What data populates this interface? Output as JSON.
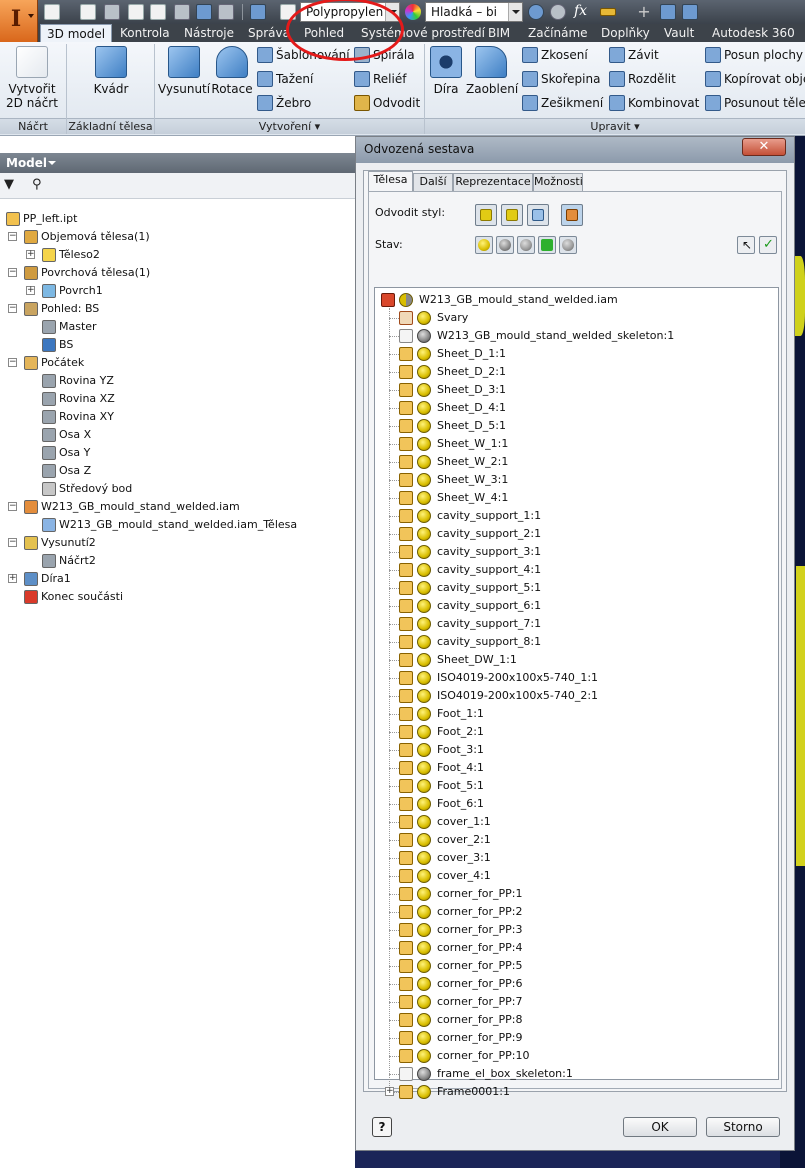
{
  "app": {
    "logo_letter": "I",
    "material": "Polypropylen",
    "appearance": "Hladká – bi",
    "fx_label": "fx",
    "menus": [
      "3D model",
      "Kontrola",
      "Nástroje",
      "Správa",
      "Pohled",
      "Systémové prostředí",
      "BIM",
      "Začínáme",
      "Doplňky",
      "Vault",
      "Autodesk 360"
    ],
    "active_menu": "3D model"
  },
  "ribbon": {
    "sketch_btn": "Vytvořit",
    "sketch_btn2": "2D náčrt",
    "box_btn": "Kvádr",
    "extrude_btn": "Vysunutí",
    "revolve_btn": "Rotace",
    "sweep_btn": "Šablonování",
    "loft_btn": "Tažení",
    "rib_btn": "Žebro",
    "coil_btn": "Spirála",
    "emboss_btn": "Reliéf",
    "derive_btn": "Odvodit",
    "hole_btn": "Díra",
    "fillet_btn": "Zaoblení",
    "chamfer_btn": "Zkosení",
    "shell_btn": "Skořepina",
    "draft_btn": "Zešikmení",
    "thread_btn": "Závit",
    "split_btn": "Rozdělit",
    "combine_btn": "Kombinovat",
    "moveface_btn": "Posun plochy",
    "copyobj_btn": "Kopírovat objek",
    "movebody_btn": "Posunout tělesa",
    "groups": {
      "sketch": "Náčrt",
      "primitives": "Základní tělesa",
      "create": "Vytvoření ▾",
      "modify": "Upravit ▾"
    }
  },
  "browser": {
    "title": "Model",
    "nodes": [
      {
        "label": "PP_left.ipt",
        "indent": 0,
        "exp": ""
      },
      {
        "label": "Objemová tělesa(1)",
        "indent": 1,
        "exp": "-"
      },
      {
        "label": "Těleso2",
        "indent": 2,
        "exp": "+"
      },
      {
        "label": "Povrchová tělesa(1)",
        "indent": 1,
        "exp": "-"
      },
      {
        "label": "Povrch1",
        "indent": 2,
        "exp": "+"
      },
      {
        "label": "Pohled: BS",
        "indent": 1,
        "exp": "-"
      },
      {
        "label": "Master",
        "indent": 2,
        "exp": ""
      },
      {
        "label": "BS",
        "indent": 2,
        "exp": ""
      },
      {
        "label": "Počátek",
        "indent": 1,
        "exp": "-"
      },
      {
        "label": "Rovina YZ",
        "indent": 2,
        "exp": ""
      },
      {
        "label": "Rovina XZ",
        "indent": 2,
        "exp": ""
      },
      {
        "label": "Rovina XY",
        "indent": 2,
        "exp": ""
      },
      {
        "label": "Osa X",
        "indent": 2,
        "exp": ""
      },
      {
        "label": "Osa Y",
        "indent": 2,
        "exp": ""
      },
      {
        "label": "Osa Z",
        "indent": 2,
        "exp": ""
      },
      {
        "label": "Středový bod",
        "indent": 2,
        "exp": ""
      },
      {
        "label": "W213_GB_mould_stand_welded.iam",
        "indent": 1,
        "exp": "-"
      },
      {
        "label": "W213_GB_mould_stand_welded.iam_Tělesa",
        "indent": 2,
        "exp": ""
      },
      {
        "label": "Vysunutí2",
        "indent": 1,
        "exp": "-"
      },
      {
        "label": "Náčrt2",
        "indent": 2,
        "exp": ""
      },
      {
        "label": "Díra1",
        "indent": 1,
        "exp": "+"
      },
      {
        "label": "Konec součásti",
        "indent": 1,
        "exp": ""
      }
    ]
  },
  "dialog": {
    "title": "Odvozená sestava",
    "close_label": "✕",
    "tabs": [
      "Tělesa",
      "Další",
      "Reprezentace",
      "Možnosti"
    ],
    "active_tab": "Tělesa",
    "derive_style_label": "Odvodit styl:",
    "status_label": "Stav:",
    "ok_label": "OK",
    "cancel_label": "Storno",
    "help_label": "?",
    "root": "W213_GB_mould_stand_welded.iam",
    "components": [
      {
        "label": "Svary",
        "state": "include",
        "kind": "weld"
      },
      {
        "label": "W213_GB_mould_stand_welded_skeleton:1",
        "state": "exclude",
        "kind": "skeleton"
      },
      {
        "label": "Sheet_D_1:1",
        "state": "include",
        "kind": "part"
      },
      {
        "label": "Sheet_D_2:1",
        "state": "include",
        "kind": "part"
      },
      {
        "label": "Sheet_D_3:1",
        "state": "include",
        "kind": "part"
      },
      {
        "label": "Sheet_D_4:1",
        "state": "include",
        "kind": "part"
      },
      {
        "label": "Sheet_D_5:1",
        "state": "include",
        "kind": "part"
      },
      {
        "label": "Sheet_W_1:1",
        "state": "include",
        "kind": "part"
      },
      {
        "label": "Sheet_W_2:1",
        "state": "include",
        "kind": "part"
      },
      {
        "label": "Sheet_W_3:1",
        "state": "include",
        "kind": "part"
      },
      {
        "label": "Sheet_W_4:1",
        "state": "include",
        "kind": "part"
      },
      {
        "label": "cavity_support_1:1",
        "state": "include",
        "kind": "part"
      },
      {
        "label": "cavity_support_2:1",
        "state": "include",
        "kind": "part"
      },
      {
        "label": "cavity_support_3:1",
        "state": "include",
        "kind": "part"
      },
      {
        "label": "cavity_support_4:1",
        "state": "include",
        "kind": "part"
      },
      {
        "label": "cavity_support_5:1",
        "state": "include",
        "kind": "part"
      },
      {
        "label": "cavity_support_6:1",
        "state": "include",
        "kind": "part"
      },
      {
        "label": "cavity_support_7:1",
        "state": "include",
        "kind": "part"
      },
      {
        "label": "cavity_support_8:1",
        "state": "include",
        "kind": "part"
      },
      {
        "label": "Sheet_DW_1:1",
        "state": "include",
        "kind": "part"
      },
      {
        "label": "ISO4019-200x100x5-740_1:1",
        "state": "include",
        "kind": "part"
      },
      {
        "label": "ISO4019-200x100x5-740_2:1",
        "state": "include",
        "kind": "part"
      },
      {
        "label": "Foot_1:1",
        "state": "include",
        "kind": "part"
      },
      {
        "label": "Foot_2:1",
        "state": "include",
        "kind": "part"
      },
      {
        "label": "Foot_3:1",
        "state": "include",
        "kind": "part"
      },
      {
        "label": "Foot_4:1",
        "state": "include",
        "kind": "part"
      },
      {
        "label": "Foot_5:1",
        "state": "include",
        "kind": "part"
      },
      {
        "label": "Foot_6:1",
        "state": "include",
        "kind": "part"
      },
      {
        "label": "cover_1:1",
        "state": "include",
        "kind": "part"
      },
      {
        "label": "cover_2:1",
        "state": "include",
        "kind": "part"
      },
      {
        "label": "cover_3:1",
        "state": "include",
        "kind": "part"
      },
      {
        "label": "cover_4:1",
        "state": "include",
        "kind": "part"
      },
      {
        "label": "corner_for_PP:1",
        "state": "include",
        "kind": "part"
      },
      {
        "label": "corner_for_PP:2",
        "state": "include",
        "kind": "part"
      },
      {
        "label": "corner_for_PP:3",
        "state": "include",
        "kind": "part"
      },
      {
        "label": "corner_for_PP:4",
        "state": "include",
        "kind": "part"
      },
      {
        "label": "corner_for_PP:5",
        "state": "include",
        "kind": "part"
      },
      {
        "label": "corner_for_PP:6",
        "state": "include",
        "kind": "part"
      },
      {
        "label": "corner_for_PP:7",
        "state": "include",
        "kind": "part"
      },
      {
        "label": "corner_for_PP:8",
        "state": "include",
        "kind": "part"
      },
      {
        "label": "corner_for_PP:9",
        "state": "include",
        "kind": "part"
      },
      {
        "label": "corner_for_PP:10",
        "state": "include",
        "kind": "part"
      },
      {
        "label": "frame_el_box_skeleton:1",
        "state": "exclude",
        "kind": "skeleton"
      },
      {
        "label": "Frame0001:1",
        "state": "include",
        "kind": "assembly"
      }
    ]
  }
}
